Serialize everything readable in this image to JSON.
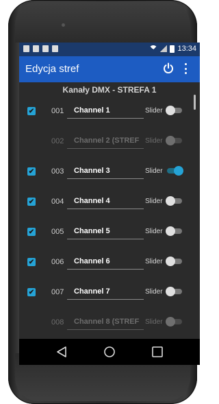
{
  "status": {
    "time": "13:34"
  },
  "appbar": {
    "title": "Edycja stref"
  },
  "section_title": "Kanały DMX - STREFA 1",
  "slider_label": "Slider",
  "channels": [
    {
      "num": "001",
      "name": "Channel 1",
      "checked": true,
      "slider_on": false,
      "enabled": true
    },
    {
      "num": "002",
      "name": "Channel 2 (STREF",
      "checked": false,
      "slider_on": false,
      "enabled": false
    },
    {
      "num": "003",
      "name": "Channel 3",
      "checked": true,
      "slider_on": true,
      "enabled": true
    },
    {
      "num": "004",
      "name": "Channel 4",
      "checked": true,
      "slider_on": false,
      "enabled": true
    },
    {
      "num": "005",
      "name": "Channel 5",
      "checked": true,
      "slider_on": false,
      "enabled": true
    },
    {
      "num": "006",
      "name": "Channel 6",
      "checked": true,
      "slider_on": false,
      "enabled": true
    },
    {
      "num": "007",
      "name": "Channel 7",
      "checked": true,
      "slider_on": false,
      "enabled": true
    },
    {
      "num": "008",
      "name": "Channel 8 (STREF",
      "checked": false,
      "slider_on": false,
      "enabled": false
    }
  ],
  "colors": {
    "appbar": "#1d5cc2",
    "accent": "#25a3d6",
    "background": "#2b2b2b"
  },
  "icons": {
    "power": "power-icon",
    "more": "more-vert-icon",
    "back": "back-icon",
    "home": "home-icon",
    "recent": "recent-apps-icon"
  }
}
